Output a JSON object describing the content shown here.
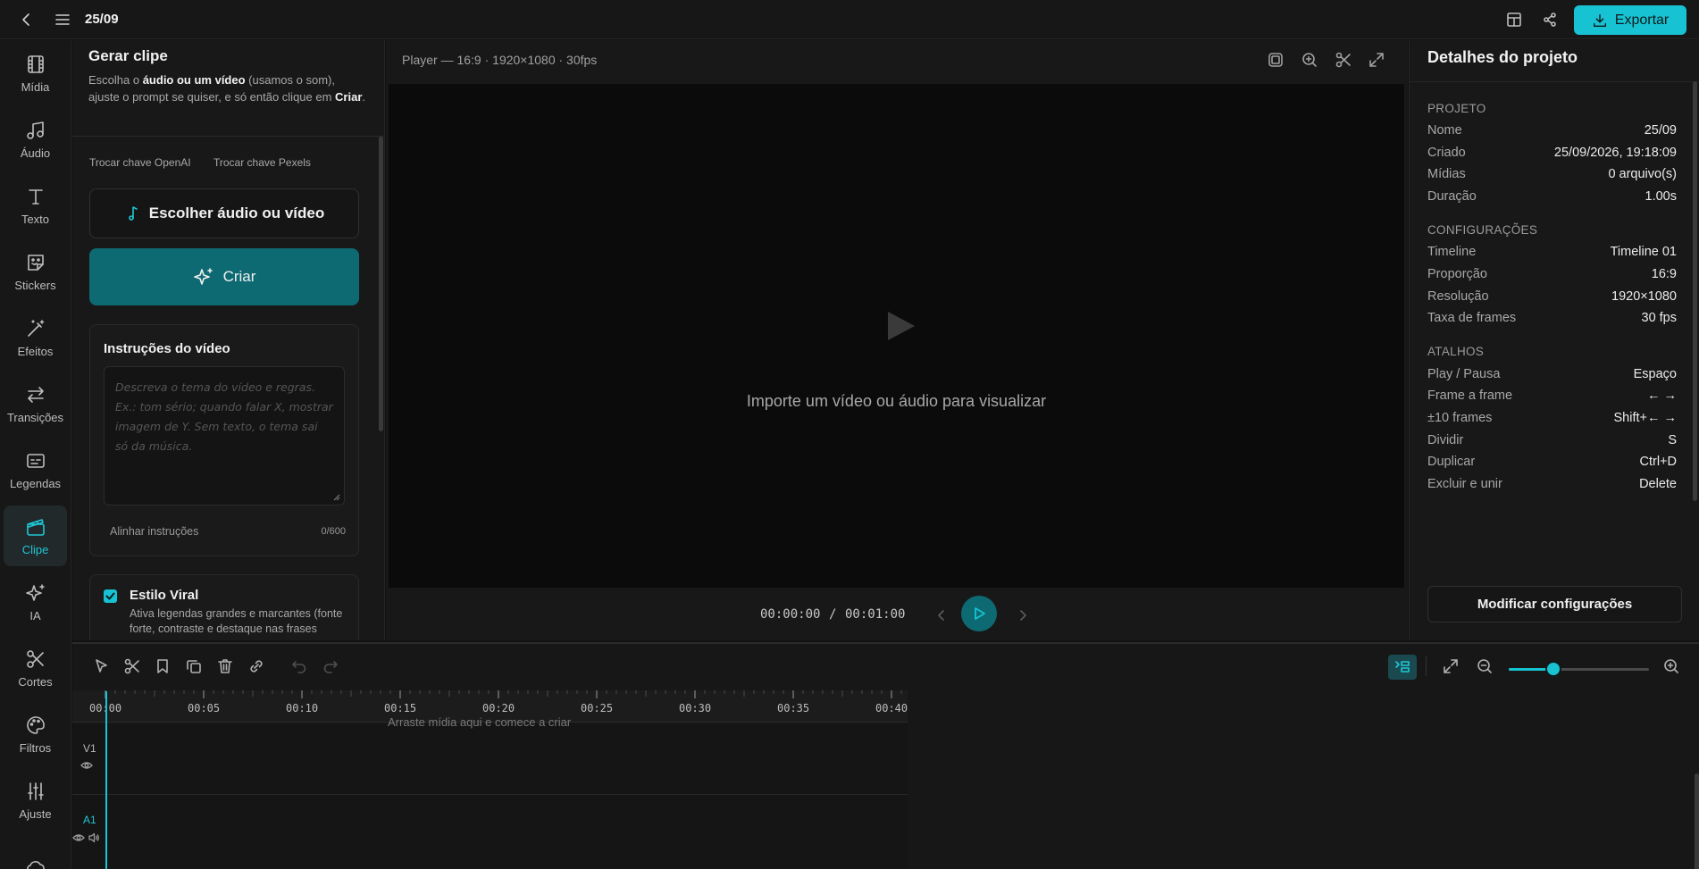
{
  "topbar": {
    "title": "25/09",
    "export_label": "Exportar"
  },
  "rail": {
    "items": [
      {
        "label": "Mídia",
        "icon": "film-icon"
      },
      {
        "label": "Áudio",
        "icon": "music-icon"
      },
      {
        "label": "Texto",
        "icon": "text-icon"
      },
      {
        "label": "Stickers",
        "icon": "sticker-icon"
      },
      {
        "label": "Efeitos",
        "icon": "magic-wand-icon"
      },
      {
        "label": "Transições",
        "icon": "transition-icon"
      },
      {
        "label": "Legendas",
        "icon": "captions-icon"
      },
      {
        "label": "Clipe",
        "icon": "clapperboard-icon",
        "active": true
      },
      {
        "label": "IA",
        "icon": "sparkles-icon"
      },
      {
        "label": "Cortes",
        "icon": "scissors-icon"
      },
      {
        "label": "Filtros",
        "icon": "palette-icon"
      },
      {
        "label": "Ajuste",
        "icon": "sliders-icon"
      },
      {
        "label": "",
        "icon": "cloud-icon"
      }
    ]
  },
  "clip_panel": {
    "title": "Gerar clipe",
    "intro_1": "Escolha o ",
    "intro_bold_1": "áudio ou um vídeo",
    "intro_2": " (usamos o som), ajuste o prompt se quiser, e só então clique em ",
    "intro_bold_2": "Criar",
    "intro_3": ".",
    "openai_key": "Trocar chave OpenAI",
    "pexels_key": "Trocar chave Pexels",
    "choose_label": "Escolher áudio ou vídeo",
    "create_label": "Criar",
    "instructions_title": "Instruções do vídeo",
    "instructions_placeholder": "Descreva o tema do vídeo e regras. Ex.: tom sério; quando falar X, mostrar imagem de Y. Sem texto, o tema sai só da música.",
    "align_label": "Alinhar instruções",
    "char_count": "0/600",
    "viral_title": "Estilo Viral",
    "viral_checked": true,
    "viral_desc": "Ativa legendas grandes e marcantes (fonte forte, contraste e destaque nas frases"
  },
  "player": {
    "meta": "Player — 16:9 · 1920×1080 · 30fps",
    "empty_text": "Importe um vídeo ou áudio para visualizar",
    "time_current": "00:00:00",
    "time_sep": "/",
    "time_total": "00:01:00"
  },
  "details": {
    "title": "Detalhes do projeto",
    "sections": {
      "project": {
        "title": "PROJETO",
        "rows": [
          {
            "k": "Nome",
            "v": "25/09"
          },
          {
            "k": "Criado",
            "v": "25/09/2026, 19:18:09"
          },
          {
            "k": "Mídias",
            "v": "0 arquivo(s)"
          },
          {
            "k": "Duração",
            "v": "1.00s"
          }
        ]
      },
      "settings": {
        "title": "CONFIGURAÇÕES",
        "rows": [
          {
            "k": "Timeline",
            "v": "Timeline 01"
          },
          {
            "k": "Proporção",
            "v": "16:9"
          },
          {
            "k": "Resolução",
            "v": "1920×1080"
          },
          {
            "k": "Taxa de frames",
            "v": "30 fps"
          }
        ]
      },
      "shortcuts": {
        "title": "ATALHOS",
        "rows": [
          {
            "k": "Play / Pausa",
            "v": "Espaço"
          },
          {
            "k": "Frame a frame",
            "v": "← →"
          },
          {
            "k": "±10 frames",
            "v": "Shift+← →"
          },
          {
            "k": "Dividir",
            "v": "S"
          },
          {
            "k": "Duplicar",
            "v": "Ctrl+D"
          },
          {
            "k": "Excluir e unir",
            "v": "Delete"
          }
        ]
      }
    },
    "modify_label": "Modificar configurações"
  },
  "timeline": {
    "ticks": [
      "00:00",
      "00:05",
      "00:10",
      "00:15",
      "00:20",
      "00:25",
      "00:30",
      "00:35",
      "00:40"
    ],
    "drop_hint": "Arraste mídia aqui e comece a criar",
    "track_v1": "V1",
    "track_a1": "A1",
    "zoom_level": 0.32,
    "accent": "#17c3d2"
  }
}
